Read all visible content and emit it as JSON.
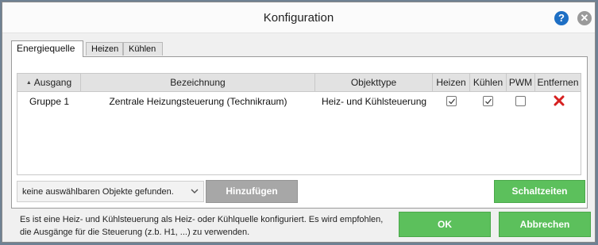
{
  "window": {
    "title": "Konfiguration",
    "help_icon": "help-icon",
    "close_icon": "close-icon"
  },
  "tabs": [
    {
      "label": "Energiequelle",
      "active": true
    },
    {
      "label": "Heizen",
      "active": false
    },
    {
      "label": "Kühlen",
      "active": false
    }
  ],
  "table": {
    "columns": [
      "Ausgang",
      "Bezeichnung",
      "Objekttype",
      "Heizen",
      "Kühlen",
      "PWM",
      "Entfernen"
    ],
    "sorted_column": "Ausgang",
    "rows": [
      {
        "ausgang": "Gruppe 1",
        "bezeichnung": "Zentrale Heizungsteuerung (Technikraum)",
        "objekttype": "Heiz- und Kühlsteuerung",
        "heizen": true,
        "kuehlen": true,
        "pwm": false,
        "remove_icon": "red-x-icon"
      }
    ]
  },
  "object_select": {
    "value": "keine auswählbaren Objekte gefunden."
  },
  "buttons": {
    "add": "Hinzufügen",
    "schedule": "Schaltzeiten",
    "ok": "OK",
    "cancel": "Abbrechen"
  },
  "info": {
    "line1": "Es ist eine Heiz- und Kühlsteuerung als Heiz- oder Kühlquelle konfiguriert. Es wird empfohlen,",
    "line2": "die Ausgänge für die Steuerung (z.b. H1, ...) zu verwenden."
  },
  "colors": {
    "accent_green": "#5cc05c",
    "help_blue": "#1e6fc4",
    "remove_red": "#d62020"
  }
}
